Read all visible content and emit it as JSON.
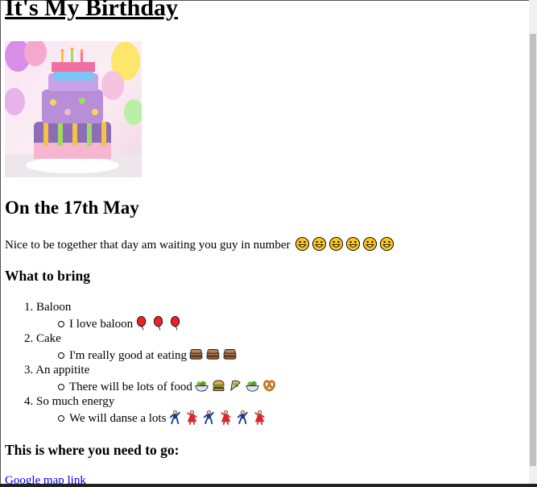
{
  "page": {
    "title": "It's My Birthday",
    "subtitle": "On the 17th May",
    "intro_text": "Nice to be together that day am waiting you guy in number",
    "intro_emoji_count": 6,
    "bring_heading": "What to bring",
    "go_heading": "This is where you need to go:",
    "map_link_text": "Google map link"
  },
  "bring_list": [
    {
      "number": "1.",
      "label": "Baloon",
      "sub": "I love baloon",
      "emojis": [
        "balloon-icon",
        "balloon-icon",
        "balloon-icon"
      ]
    },
    {
      "number": "2.",
      "label": "Cake",
      "sub": "I'm really good at eating",
      "emojis": [
        "pancake-icon",
        "pancake-icon",
        "pancake-icon"
      ]
    },
    {
      "number": "3.",
      "label": "An appitite",
      "sub": "There will be lots of food",
      "emojis": [
        "salad-icon",
        "burger-icon",
        "falafel-icon",
        "salad-icon",
        "pretzel-icon"
      ]
    },
    {
      "number": "4.",
      "label": "So much energy",
      "sub": "We will danse a lots",
      "emojis": [
        "dancer-man-icon",
        "dancer-woman-icon",
        "dancer-man-icon",
        "dancer-woman-icon",
        "dancer-man-icon",
        "dancer-woman-icon"
      ]
    }
  ],
  "colors": {
    "link": "#0000ee",
    "emoji_face": "#f9c31b",
    "balloon": "#e8212b",
    "cake_purple": "#b88ed8",
    "cake_pink": "#f7b6cf"
  }
}
